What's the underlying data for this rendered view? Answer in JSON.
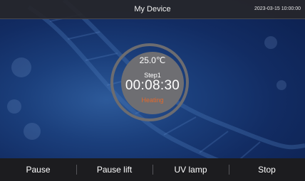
{
  "header": {
    "title": "My Device",
    "datetime": "2023-03-15  10:00:00"
  },
  "dial": {
    "temperature": "25.0℃",
    "step": "Step1",
    "timer": "00:08:30",
    "status": "Heating",
    "status_color": "#e4682b"
  },
  "controls": {
    "pause": "Pause",
    "pause_lift": "Pause lift",
    "uv_lamp": "UV lamp",
    "stop": "Stop"
  }
}
